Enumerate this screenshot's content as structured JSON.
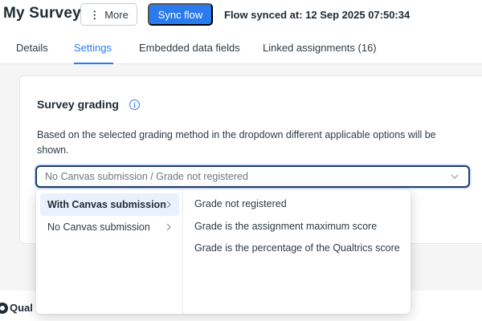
{
  "header": {
    "title": "My Survey",
    "more_label": "More",
    "sync_label": "Sync flow",
    "sync_status": "Flow synced at: 12 Sep 2025 07:50:34"
  },
  "tabs": [
    {
      "label": "Details",
      "active": false
    },
    {
      "label": "Settings",
      "active": true
    },
    {
      "label": "Embedded data fields",
      "active": false
    },
    {
      "label": "Linked assignments (16)",
      "active": false
    }
  ],
  "grading": {
    "title": "Survey grading",
    "description": "Based on the selected grading method in the dropdown different applicable options will be shown.",
    "selected_value": "No Canvas submission / Grade not registered"
  },
  "dropdown": {
    "categories": [
      {
        "label": "With Canvas submission",
        "highlighted": true
      },
      {
        "label": "No Canvas submission",
        "highlighted": false
      }
    ],
    "options": [
      "Grade not registered",
      "Grade is the assignment maximum score",
      "Grade is the percentage of the Qualtrics score"
    ]
  },
  "footer": {
    "logo_text": "Qual"
  },
  "colors": {
    "accent": "#2b7bf0",
    "focus_border": "#1d3a6e",
    "highlight_bg": "#e8f1fd"
  }
}
